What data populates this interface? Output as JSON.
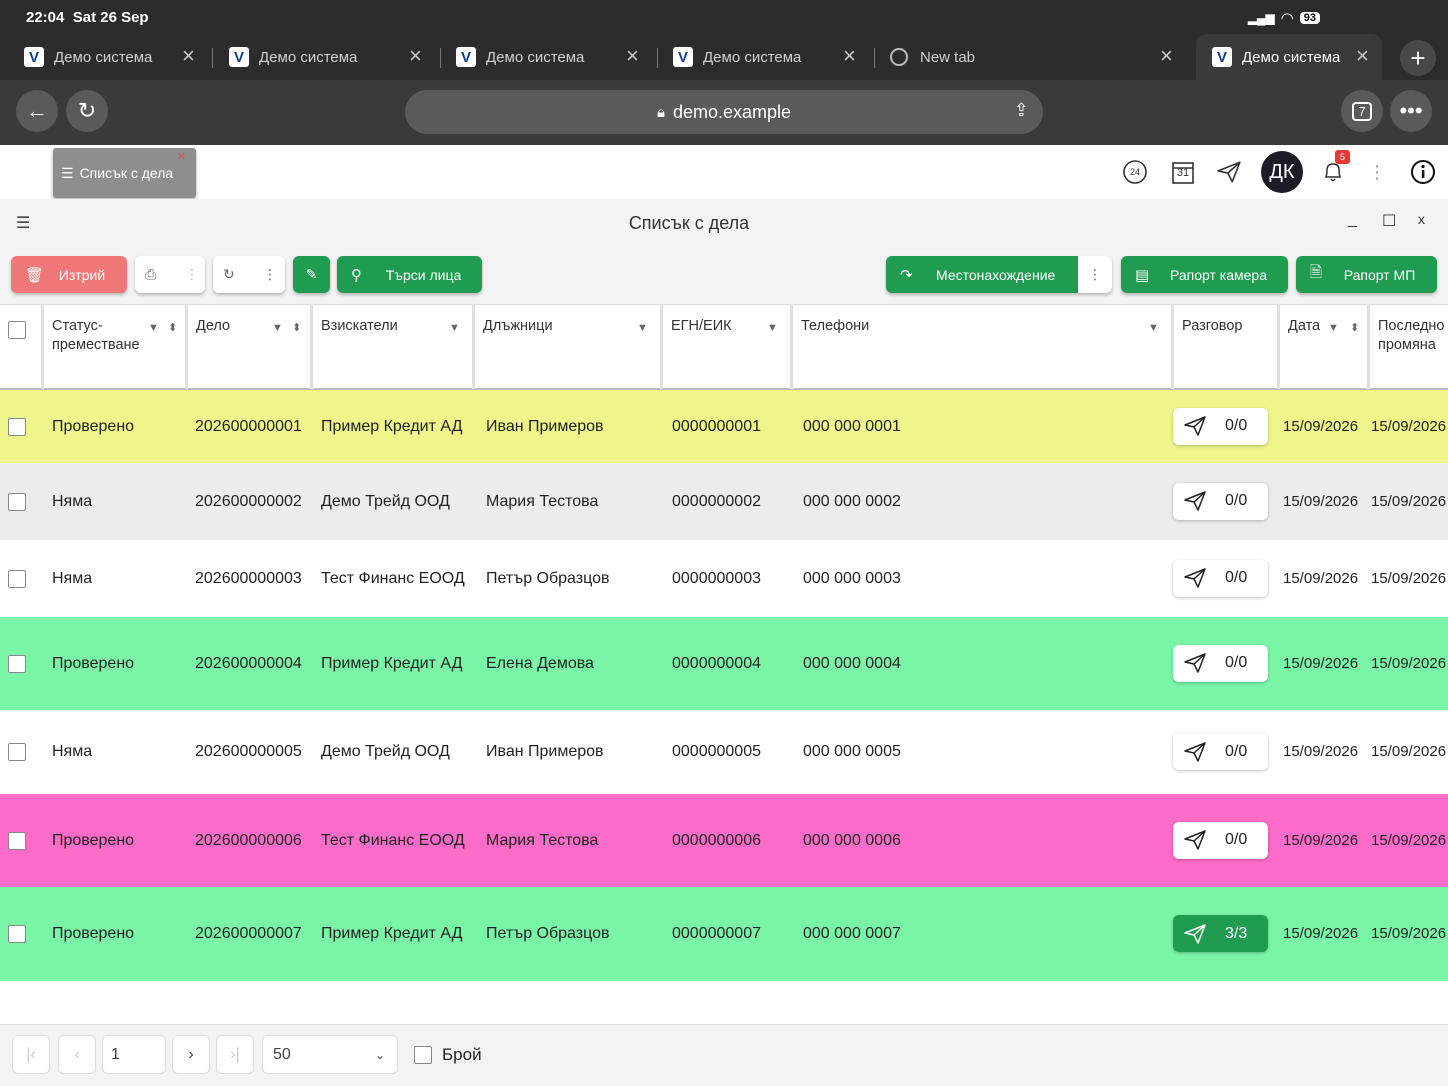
{
  "status_bar": {
    "time": "22:04",
    "date": "Sat 26 Sep",
    "battery": "93"
  },
  "tabs": [
    {
      "label": "Демо система"
    },
    {
      "label": "Демо система"
    },
    {
      "label": "Демо система"
    },
    {
      "label": "Демо система"
    },
    {
      "label": "New tab"
    },
    {
      "label": "Демо система"
    }
  ],
  "tab_count": "7",
  "url": "demo.example",
  "header": {
    "chip_label": "Списък с дела",
    "calendar_day": "31",
    "avatar_initials": "ДК",
    "notification_count": "5",
    "clock_label": "24"
  },
  "window_title": "Списък с дела",
  "toolbar": {
    "delete": "Изтрий",
    "search_people": "Търси лица",
    "location": "Местонахождение",
    "report_camera": "Рапорт камера",
    "report_mp": "Рапорт МП"
  },
  "columns": [
    "Статус-преместване",
    "Дело",
    "Взискатели",
    "Длъжници",
    "ЕГН/ЕИК",
    "Телефони",
    "Разговор",
    "Дата",
    "Последно промяна"
  ],
  "rows": [
    {
      "status": "Проверено",
      "case": "202600000001",
      "creditor": "Пример Кредит АД",
      "debtor": "Иван Примеров",
      "egn": "0000000001",
      "phone": "000 000 0001",
      "talk": "0/0",
      "date": "15/09/2026",
      "changed": "15/09/2026",
      "color": "#eef58a"
    },
    {
      "status": "Няма",
      "case": "202600000002",
      "creditor": "Демо Трейд ООД",
      "debtor": "Мария Тестова",
      "egn": "0000000002",
      "phone": "000 000 0002",
      "talk": "0/0",
      "date": "15/09/2026",
      "changed": "15/09/2026",
      "color": "#ececec"
    },
    {
      "status": "Няма",
      "case": "202600000003",
      "creditor": "Тест Финанс ЕООД",
      "debtor": "Петър Образцов",
      "egn": "0000000003",
      "phone": "000 000 0003",
      "talk": "0/0",
      "date": "15/09/2026",
      "changed": "15/09/2026",
      "color": "#ffffff"
    },
    {
      "status": "Проверено",
      "case": "202600000004",
      "creditor": "Пример Кредит АД",
      "debtor": "Елена Демова",
      "egn": "0000000004",
      "phone": "000 000 0004",
      "talk": "0/0",
      "date": "15/09/2026",
      "changed": "15/09/2026",
      "color": "#7af5a8"
    },
    {
      "status": "Няма",
      "case": "202600000005",
      "creditor": "Демо Трейд ООД",
      "debtor": "Иван Примеров",
      "egn": "0000000005",
      "phone": "000 000 0005",
      "talk": "0/0",
      "date": "15/09/2026",
      "changed": "15/09/2026",
      "color": "#ffffff"
    },
    {
      "status": "Проверено",
      "case": "202600000006",
      "creditor": "Тест Финанс ЕООД",
      "debtor": "Мария Тестова",
      "egn": "0000000006",
      "phone": "000 000 0006",
      "talk": "0/0",
      "date": "15/09/2026",
      "changed": "15/09/2026",
      "color": "#fd6cc8"
    },
    {
      "status": "Проверено",
      "case": "202600000007",
      "creditor": "Пример Кредит АД",
      "debtor": "Петър Образцов",
      "egn": "0000000007",
      "phone": "000 000 0007",
      "talk": "3/3",
      "date": "15/09/2026",
      "changed": "15/09/2026",
      "color": "#7af5a8"
    }
  ],
  "pagination": {
    "page": "1",
    "page_size": "50",
    "count_label": "Брой"
  }
}
